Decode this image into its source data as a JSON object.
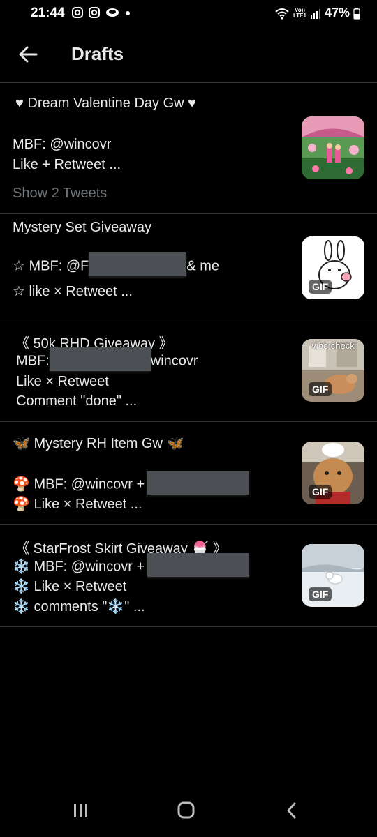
{
  "status_bar": {
    "time": "21:44",
    "network_label_top": "Vo))",
    "network_label_bottom": "LTE1",
    "battery": "47%"
  },
  "header": {
    "title": "Drafts"
  },
  "drafts": [
    {
      "line1": "♥ Dream Valentine Day Gw ♥",
      "line2": "MBF: @wincovr",
      "line3": "Like + Retweet ...",
      "show_more": "Show 2 Tweets"
    },
    {
      "line1": "Mystery Set Giveaway",
      "line2a": "☆ MBF: @F",
      "line2b": "& me",
      "line3": "☆ like × Retweet ...",
      "gif_label": "GIF"
    },
    {
      "line1": "《 50k RHD Giveaway 》",
      "line2a": "MBF:",
      "line2b": "wincovr",
      "line3": "Like × Retweet",
      "line4": "Comment \"done\" ...",
      "thumb_caption": "vibe check",
      "gif_label": "GIF"
    },
    {
      "line1": "🦋 Mystery RH Item Gw 🦋",
      "line2": "🍄 MBF: @wincovr +",
      "line3": "🍄 Like × Retweet ...",
      "gif_label": "GIF"
    },
    {
      "line1": "《 StarFrost Skirt Giveaway 🍧 》",
      "line2": "❄️ MBF: @wincovr +",
      "line3": "❄️ Like × Retweet",
      "line4": "❄️ comments \"❄️\" ...",
      "gif_label": "GIF"
    }
  ],
  "colors": {
    "background": "#000000",
    "text": "#e7e9ea",
    "muted": "#71767b",
    "divider": "#2f3336"
  },
  "icons": [
    "back-arrow-icon",
    "instagram-icon",
    "snapchat-icon",
    "wifi-icon",
    "signal-icon",
    "battery-icon",
    "recents-icon",
    "home-icon",
    "system-back-icon"
  ]
}
